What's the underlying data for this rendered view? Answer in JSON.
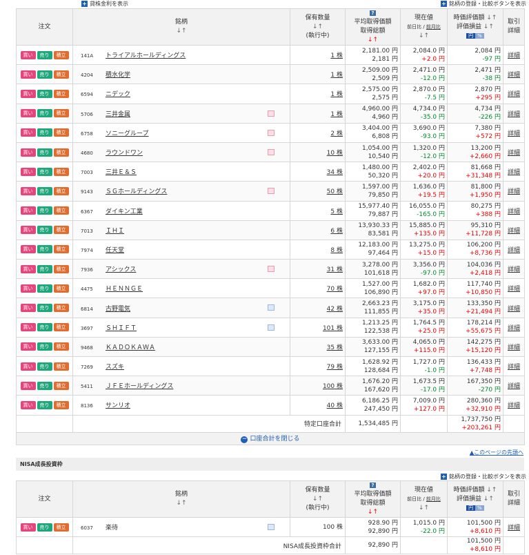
{
  "top": {
    "left_link": "貸株金利を表示",
    "right_link": "銘柄の登録・比較ボタンを表示"
  },
  "header": {
    "order": "注文",
    "stock": "銘柄",
    "sort": "↓↑",
    "qty": "保有数量",
    "qty_sub": "(執行中)",
    "avg": "平均取得価額",
    "cost": "取得総額",
    "avg_sort": "↓↑",
    "price": "現在値",
    "prev_day": "前日比",
    "prev_sep": " / ",
    "prev_month": "前月比",
    "value": "時価評価額",
    "pl": "評価損益",
    "yen": "円",
    "pct": "%",
    "detail1": "取引",
    "detail2": "詳細",
    "help": "?"
  },
  "buttons": {
    "buy": "買い",
    "sell": "売り",
    "acc": "積立"
  },
  "rows": [
    {
      "code": "141A",
      "name": "トライアルホールディングス",
      "qty": "1 株",
      "avg": "2,181.00 円",
      "cost": "2,181 円",
      "price": "2,084.0 円",
      "chg": "+2.0 円",
      "value": "2,084 円",
      "pl": "-97 円",
      "chg_color": "red",
      "pl_color": "green",
      "icon": ""
    },
    {
      "code": "4204",
      "name": "積水化学",
      "qty": "1 株",
      "avg": "2,509.00 円",
      "cost": "2,509 円",
      "price": "2,471.0 円",
      "chg": "-12.0 円",
      "value": "2,471 円",
      "pl": "-38 円",
      "chg_color": "green",
      "pl_color": "green",
      "icon": ""
    },
    {
      "code": "6594",
      "name": "ニデック",
      "qty": "1 株",
      "avg": "2,575.00 円",
      "cost": "2,575 円",
      "price": "2,870.0 円",
      "chg": "-7.5 円",
      "value": "2,870 円",
      "pl": "+295 円",
      "chg_color": "green",
      "pl_color": "red",
      "icon": ""
    },
    {
      "code": "5706",
      "name": "三井金属",
      "qty": "1 株",
      "avg": "4,960.00 円",
      "cost": "4,960 円",
      "price": "4,734.0 円",
      "chg": "-35.0 円",
      "value": "4,734 円",
      "pl": "-226 円",
      "chg_color": "green",
      "pl_color": "green",
      "icon": "red"
    },
    {
      "code": "6758",
      "name": "ソニーグループ",
      "qty": "2 株",
      "avg": "3,404.00 円",
      "cost": "6,808 円",
      "price": "3,690.0 円",
      "chg": "-93.0 円",
      "value": "7,380 円",
      "pl": "+572 円",
      "chg_color": "green",
      "pl_color": "red",
      "icon": "red"
    },
    {
      "code": "4680",
      "name": "ラウンドワン",
      "qty": "10 株",
      "avg": "1,054.00 円",
      "cost": "10,540 円",
      "price": "1,320.0 円",
      "chg": "-12.0 円",
      "value": "13,200 円",
      "pl": "+2,660 円",
      "chg_color": "green",
      "pl_color": "red",
      "icon": "red"
    },
    {
      "code": "7003",
      "name": "三井Ｅ＆Ｓ",
      "qty": "34 株",
      "avg": "1,480.00 円",
      "cost": "50,320 円",
      "price": "2,402.0 円",
      "chg": "+20.0 円",
      "value": "81,668 円",
      "pl": "+31,348 円",
      "chg_color": "red",
      "pl_color": "red",
      "icon": ""
    },
    {
      "code": "9143",
      "name": "ＳＧホールディングス",
      "qty": "50 株",
      "avg": "1,597.00 円",
      "cost": "79,850 円",
      "price": "1,636.0 円",
      "chg": "+19.5 円",
      "value": "81,800 円",
      "pl": "+1,950 円",
      "chg_color": "red",
      "pl_color": "red",
      "icon": "red"
    },
    {
      "code": "6367",
      "name": "ダイキン工業",
      "qty": "5 株",
      "avg": "15,977.40 円",
      "cost": "79,887 円",
      "price": "16,055.0 円",
      "chg": "-165.0 円",
      "value": "80,275 円",
      "pl": "+388 円",
      "chg_color": "green",
      "pl_color": "red",
      "icon": ""
    },
    {
      "code": "7013",
      "name": "ＩＨＩ",
      "qty": "6 株",
      "avg": "13,930.33 円",
      "cost": "83,581 円",
      "price": "15,885.0 円",
      "chg": "+135.0 円",
      "value": "95,310 円",
      "pl": "+11,728 円",
      "chg_color": "red",
      "pl_color": "red",
      "icon": ""
    },
    {
      "code": "7974",
      "name": "任天堂",
      "qty": "8 株",
      "avg": "12,183.00 円",
      "cost": "97,464 円",
      "price": "13,275.0 円",
      "chg": "+15.0 円",
      "value": "106,200 円",
      "pl": "+8,736 円",
      "chg_color": "red",
      "pl_color": "red",
      "icon": ""
    },
    {
      "code": "7936",
      "name": "アシックス",
      "qty": "31 株",
      "avg": "3,278.00 円",
      "cost": "101,618 円",
      "price": "3,356.0 円",
      "chg": "-97.0 円",
      "value": "104,036 円",
      "pl": "+2,418 円",
      "chg_color": "green",
      "pl_color": "red",
      "icon": "red"
    },
    {
      "code": "4475",
      "name": "ＨＥＮＮＧＥ",
      "qty": "70 株",
      "avg": "1,527.00 円",
      "cost": "106,890 円",
      "price": "1,682.0 円",
      "chg": "+97.0 円",
      "value": "117,740 円",
      "pl": "+10,850 円",
      "chg_color": "red",
      "pl_color": "red",
      "icon": ""
    },
    {
      "code": "6814",
      "name": "古野電気",
      "qty": "42 株",
      "avg": "2,663.23 円",
      "cost": "111,855 円",
      "price": "3,175.0 円",
      "chg": "+35.0 円",
      "value": "133,350 円",
      "pl": "+21,494 円",
      "chg_color": "red",
      "pl_color": "red",
      "icon": "blue"
    },
    {
      "code": "3697",
      "name": "ＳＨＩＦＴ",
      "qty": "101 株",
      "avg": "1,213.25 円",
      "cost": "122,538 円",
      "price": "1,764.5 円",
      "chg": "+25.0 円",
      "value": "178,214 円",
      "pl": "+55,675 円",
      "chg_color": "red",
      "pl_color": "red",
      "icon": "blue"
    },
    {
      "code": "9468",
      "name": "ＫＡＤＯＫＡＷＡ",
      "qty": "35 株",
      "avg": "3,633.00 円",
      "cost": "127,155 円",
      "price": "4,065.0 円",
      "chg": "+115.0 円",
      "value": "142,275 円",
      "pl": "+15,120 円",
      "chg_color": "red",
      "pl_color": "red",
      "icon": ""
    },
    {
      "code": "7269",
      "name": "スズキ",
      "qty": "79 株",
      "avg": "1,628.92 円",
      "cost": "128,684 円",
      "price": "1,727.0 円",
      "chg": "-1.0 円",
      "value": "136,433 円",
      "pl": "+7,748 円",
      "chg_color": "green",
      "pl_color": "red",
      "icon": ""
    },
    {
      "code": "5411",
      "name": "ＪＦＥホールディングス",
      "qty": "100 株",
      "avg": "1,676.20 円",
      "cost": "167,620 円",
      "price": "1,673.5 円",
      "chg": "-17.0 円",
      "value": "167,350 円",
      "pl": "-270 円",
      "chg_color": "green",
      "pl_color": "green",
      "icon": ""
    },
    {
      "code": "8136",
      "name": "サンリオ",
      "qty": "40 株",
      "avg": "6,186.25 円",
      "cost": "247,450 円",
      "price": "7,009.0 円",
      "chg": "+127.0 円",
      "value": "280,360 円",
      "pl": "+32,910 円",
      "chg_color": "red",
      "pl_color": "red",
      "icon": ""
    }
  ],
  "total": {
    "label": "特定口座合計",
    "cost": "1,534,485 円",
    "value": "1,737,750 円",
    "pl": "+203,261 円"
  },
  "close_label": "口座合計を閉じる",
  "pagetop": "▲このページの先頭へ",
  "nisa": {
    "title": "NISA成長投資枠",
    "right_link": "銘柄の登録・比較ボタンを表示",
    "row": {
      "code": "6037",
      "name": "楽待",
      "qty": "100 株",
      "avg": "928.90 円",
      "cost": "92,890 円",
      "price": "1,015.0 円",
      "chg": "-22.0 円",
      "value": "101,500 円",
      "pl": "+8,610 円"
    },
    "total": {
      "label": "NISA成長投資枠合計",
      "cost": "92,890 円",
      "value": "101,500 円",
      "pl": "+8,610 円"
    }
  },
  "colors": {
    "buy": "#e5457a",
    "sell": "#1fa67a",
    "acc": "#e06d2f",
    "up": "#e00",
    "down": "#008a2e",
    "link": "#1f5fb4"
  }
}
